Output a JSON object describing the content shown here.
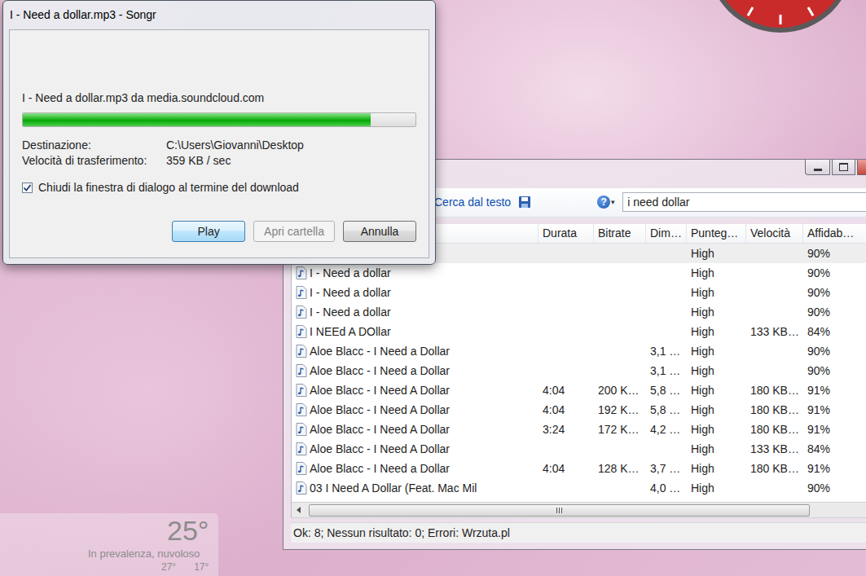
{
  "dialog": {
    "title": "I - Need a dollar.mp3 - Songr",
    "source": "I - Need a dollar.mp3 da media.soundcloud.com",
    "progress": {
      "level": 0.886
    },
    "fields": [
      {
        "label": "Destinazione:",
        "value": "C:\\Users\\Giovanni\\Desktop"
      },
      {
        "label": "Velocità di trasferimento:",
        "value": "359 KB / sec"
      }
    ],
    "checkbox": {
      "label": "Chiudi la finestra di dialogo al termine del download",
      "checked": true
    },
    "buttons": [
      {
        "label": "Play",
        "disabled": false,
        "default": true
      },
      {
        "label": "Apri cartella",
        "disabled": true,
        "default": false
      },
      {
        "label": "Annulla",
        "disabled": false,
        "default": false
      }
    ]
  },
  "main_window": {
    "toolbar": {
      "search_by_text": "Cerca dal testo",
      "help": "?",
      "help_arrow": "▾",
      "search": {
        "value": "i need dollar"
      }
    },
    "table": {
      "columns": [
        {
          "label": ""
        },
        {
          "label": "Durata"
        },
        {
          "label": "Bitrate"
        },
        {
          "label": "Dim…"
        },
        {
          "label": "Punteg…"
        },
        {
          "label": "Velocità"
        },
        {
          "label": "Affidab…"
        }
      ],
      "rows": [
        {
          "selected": true,
          "cells": [
            "",
            "",
            "",
            "",
            "High",
            "",
            "90%"
          ]
        },
        {
          "selected": false,
          "cells": [
            "I - Need a dollar",
            "",
            "",
            "",
            "High",
            "",
            "90%"
          ]
        },
        {
          "selected": false,
          "cells": [
            "I - Need a dollar",
            "",
            "",
            "",
            "High",
            "",
            "90%"
          ]
        },
        {
          "selected": false,
          "cells": [
            "I - Need a dollar",
            "",
            "",
            "",
            "High",
            "",
            "90%"
          ]
        },
        {
          "selected": false,
          "cells": [
            "I NEEd A DOllar",
            "",
            "",
            "",
            "High",
            "133 KB…",
            "84%"
          ]
        },
        {
          "selected": false,
          "cells": [
            "Aloe Blacc - I Need a Dollar",
            "",
            "",
            "3,1 …",
            "High",
            "",
            "90%"
          ]
        },
        {
          "selected": false,
          "cells": [
            "Aloe Blacc - I Need a Dollar",
            "",
            "",
            "3,1 …",
            "High",
            "",
            "90%"
          ]
        },
        {
          "selected": false,
          "cells": [
            "Aloe Blacc - I Need A Dollar",
            "4:04",
            "200 K…",
            "5,8 …",
            "High",
            "180 KB…",
            "91%"
          ]
        },
        {
          "selected": false,
          "cells": [
            "Aloe Blacc - I Need A Dollar",
            "4:04",
            "192 K…",
            "5,8 …",
            "High",
            "180 KB…",
            "91%"
          ]
        },
        {
          "selected": false,
          "cells": [
            "Aloe Blacc - I Need A Dollar",
            "3:24",
            "172 K…",
            "4,2 …",
            "High",
            "180 KB…",
            "91%"
          ]
        },
        {
          "selected": false,
          "cells": [
            "Aloe Blacc - I Need A Dollar",
            "",
            "",
            "",
            "High",
            "133 KB…",
            "84%"
          ]
        },
        {
          "selected": false,
          "cells": [
            "Aloe Blacc - I Need a Dollar",
            "4:04",
            "128 K…",
            "3,7 …",
            "High",
            "180 KB…",
            "91%"
          ]
        },
        {
          "selected": false,
          "cells": [
            "03 I Need A Dollar (Feat. Mac Mil",
            "",
            "",
            "4,0 …",
            "High",
            "",
            "90%"
          ]
        }
      ]
    },
    "status_bar": "Ok: 8; Nessun risultato: 0; Errori: Wrzuta.pl"
  },
  "weather": {
    "temperature": "25°",
    "condition": "In prevalenza, nuvoloso",
    "high": "27°",
    "low": "17°"
  }
}
